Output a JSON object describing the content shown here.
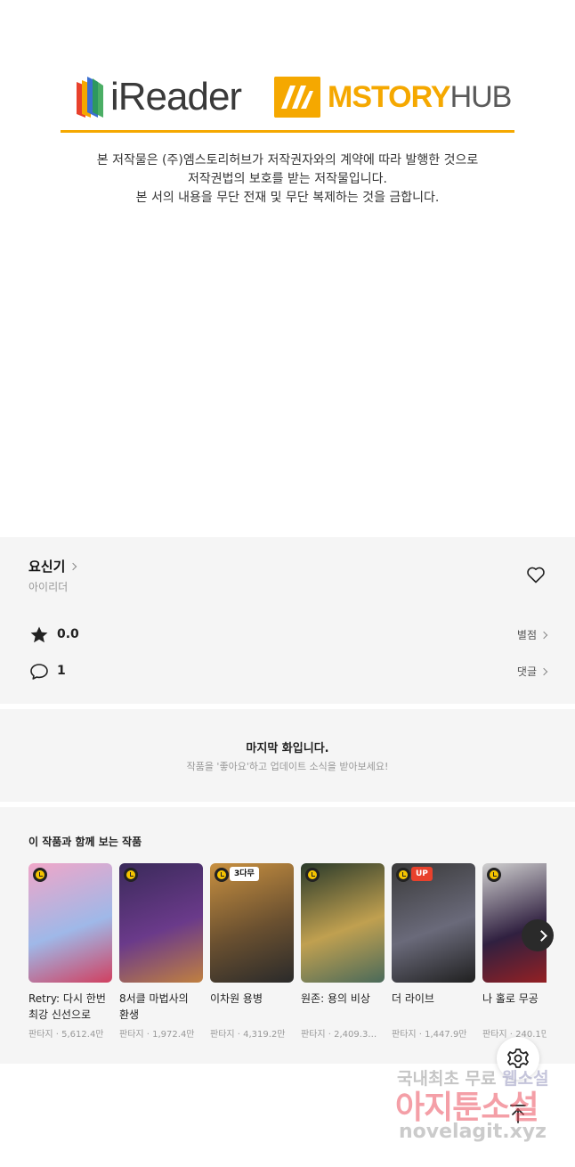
{
  "banner": {
    "ireader_logo": "iReader",
    "mstory_logo_main": "MSTORY",
    "mstory_logo_hub": "HUB",
    "accent_color": "#f5a800",
    "notice": [
      "본 저작물은 (주)엠스토리허브가 저작권자와의 계약에 따라 발행한 것으로",
      "저작권법의 보호를 받는 저작물입니다.",
      "본 서의 내용을 무단 전재 및 무단 복제하는 것을 금합니다."
    ]
  },
  "work": {
    "title": "요신기",
    "author": "아이리더",
    "favorite_icon": "heart-icon",
    "rating": "0.0",
    "rating_link": "별점",
    "comment_count": "1",
    "comment_link": "댓글"
  },
  "last_episode": {
    "title": "마지막 화입니다.",
    "subtitle": "작품을 '좋아요'하고 업데이트 소식을 받아보세요!"
  },
  "recommendations": {
    "heading": "이 작품과 함께 보는 작품",
    "items": [
      {
        "name": "Retry: 다시 한번 최강 신선으로",
        "meta": "판타지 · 5,612.4만",
        "tag": "",
        "colors": [
          "#f0a6c8",
          "#9fb8e8",
          "#d04060"
        ]
      },
      {
        "name": "8서클 마법사의 환생",
        "meta": "판타지 · 1,972.4만",
        "tag": "",
        "colors": [
          "#3a2a5a",
          "#6a3a8a",
          "#c08040"
        ]
      },
      {
        "name": "이차원 용병",
        "meta": "판타지 · 4,319.2만",
        "tag": "3다무",
        "colors": [
          "#c89040",
          "#6a5030",
          "#2a2a2a"
        ]
      },
      {
        "name": "원존: 용의 비상",
        "meta": "판타지 · 2,409.3…",
        "tag": "",
        "colors": [
          "#2a3a2a",
          "#c0a050",
          "#4a6a5a"
        ]
      },
      {
        "name": "더 라이브",
        "meta": "판타지 · 1,447.9만",
        "tag": "UP",
        "colors": [
          "#3a3a3a",
          "#6a6a7a",
          "#202020"
        ]
      },
      {
        "name": "나 홀로 무공",
        "meta": "판타지 · 240.1만",
        "tag": "",
        "colors": [
          "#d0d0d0",
          "#302040",
          "#a02020"
        ]
      }
    ]
  },
  "controls": {
    "next_icon": "chevron-right-icon",
    "settings_icon": "gear-icon",
    "scroll_top_icon": "arrow-up-icon"
  },
  "watermark": {
    "line1_a": "국내최초 무료 ",
    "line1_b": "웹소설",
    "line2": "아지툰소설",
    "line3": "novelagit.xyz"
  }
}
